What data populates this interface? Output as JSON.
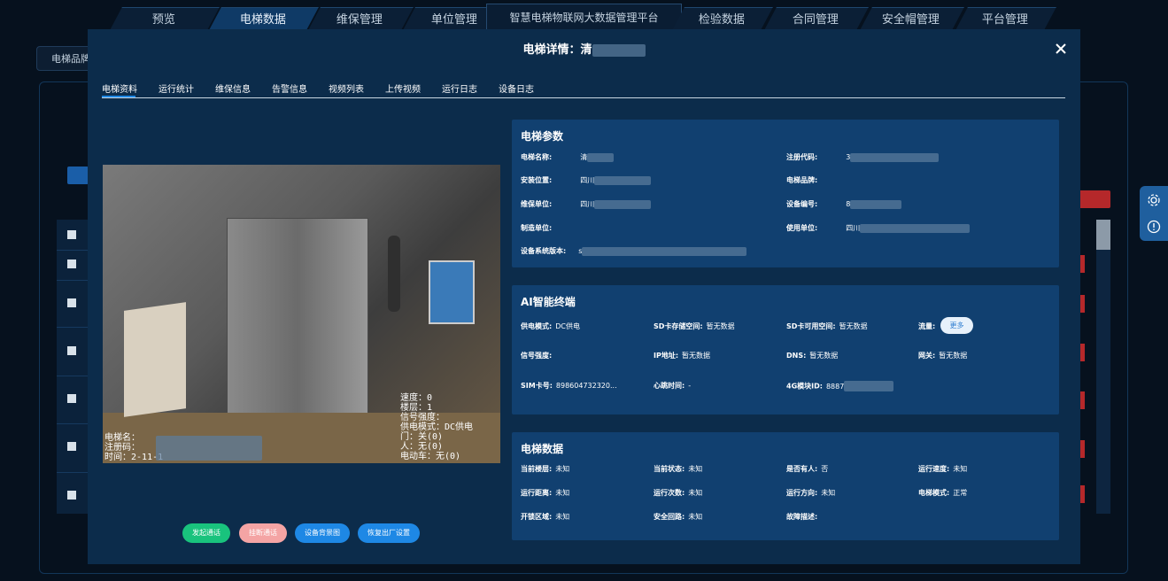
{
  "nav": {
    "left_tabs": [
      "预览",
      "电梯数据",
      "维保管理",
      "单位管理"
    ],
    "center_title": "智慧电梯物联网大数据管理平台",
    "right_tabs": [
      "检验数据",
      "合同管理",
      "安全帽管理",
      "平台管理"
    ],
    "active": "电梯数据"
  },
  "background": {
    "breadcrumb": "电梯品牌"
  },
  "modal": {
    "title_prefix": "电梯详情：清",
    "tabs": [
      "电梯资料",
      "运行统计",
      "维保信息",
      "告警信息",
      "视频列表",
      "上传视频",
      "运行日志",
      "设备日志"
    ],
    "active_tab": "电梯资料",
    "video_overlay": {
      "right_lines": [
        "速度：0",
        "楼层：1",
        "信号强度：",
        "供电模式：DC供电",
        "门：关(0)",
        "人：无(0)",
        "电动车：无(0)"
      ],
      "left_lines": [
        "电梯名：",
        "注册码：",
        "时间：2",
        "-11-1"
      ]
    },
    "buttons": {
      "start_call": "发起通话",
      "hang_up": "挂断通话",
      "device_bg": "设备背景图",
      "factory_reset": "恢复出厂设置"
    },
    "elevator_params": {
      "title": "电梯参数",
      "name_label": "电梯名称:",
      "name_value": "清",
      "reg_label": "注册代码:",
      "reg_value": "3",
      "location_label": "安装位置:",
      "location_value": "四川",
      "brand_label": "电梯品牌:",
      "brand_value": "",
      "maint_label": "维保单位:",
      "maint_value": "四川",
      "device_no_label": "设备编号:",
      "device_no_value": "8",
      "maker_label": "制造单位:",
      "maker_value": "",
      "user_unit_label": "使用单位:",
      "user_unit_value": "四川",
      "sysver_label": "设备系统版本:",
      "sysver_value": "s"
    },
    "ai_terminal": {
      "title": "AI智能终端",
      "power_label": "供电模式:",
      "power_value": "DC供电",
      "sd_total_label": "SD卡存储空间:",
      "sd_total_value": "暂无数据",
      "sd_free_label": "SD卡可用空间:",
      "sd_free_value": "暂无数据",
      "traffic_label": "流量:",
      "more_label": "更多",
      "signal_label": "信号强度:",
      "signal_value": "",
      "ip_label": "IP地址:",
      "ip_value": "暂无数据",
      "dns_label": "DNS:",
      "dns_value": "暂无数据",
      "gateway_label": "网关:",
      "gateway_value": "暂无数据",
      "sim_label": "SIM卡号:",
      "sim_value": "898604732320...",
      "heartbeat_label": "心跳时间:",
      "heartbeat_value": "-",
      "module4g_label": "4G模块ID:",
      "module4g_value": "8887"
    },
    "elevator_data": {
      "title": "电梯数据",
      "floor_label": "当前楼层:",
      "floor_value": "未知",
      "state_label": "当前状态:",
      "state_value": "未知",
      "person_label": "是否有人:",
      "person_value": "否",
      "speed_label": "运行速度:",
      "speed_value": "未知",
      "distance_label": "运行距离:",
      "distance_value": "未知",
      "count_label": "运行次数:",
      "count_value": "未知",
      "direction_label": "运行方向:",
      "direction_value": "未知",
      "mode_label": "电梯模式:",
      "mode_value": "正常",
      "door_zone_label": "开锁区域:",
      "door_zone_value": "未知",
      "safety_label": "安全回路:",
      "safety_value": "未知",
      "fault_label": "故障描述:",
      "fault_value": ""
    }
  }
}
